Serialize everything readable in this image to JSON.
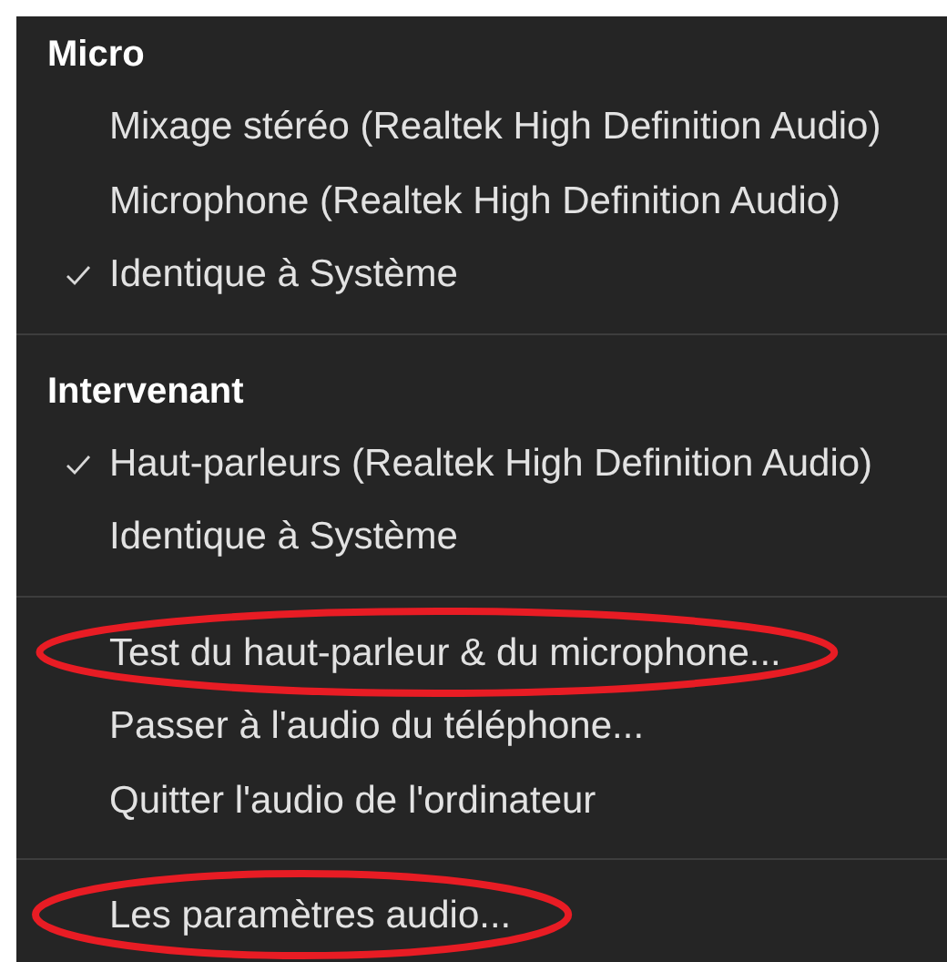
{
  "menu": {
    "sections": [
      {
        "header": "Micro",
        "items": [
          {
            "label": "Mixage stéréo (Realtek High Definition Audio)",
            "checked": false,
            "circled": false
          },
          {
            "label": "Microphone (Realtek High Definition Audio)",
            "checked": false,
            "circled": false
          },
          {
            "label": "Identique à Système",
            "checked": true,
            "circled": false
          }
        ]
      },
      {
        "header": "Intervenant",
        "items": [
          {
            "label": "Haut-parleurs (Realtek High Definition Audio)",
            "checked": true,
            "circled": false
          },
          {
            "label": "Identique à Système",
            "checked": false,
            "circled": false
          }
        ]
      },
      {
        "items": [
          {
            "label": "Test du haut-parleur & du microphone...",
            "checked": false,
            "circled": true
          },
          {
            "label": "Passer à l'audio du téléphone...",
            "checked": false,
            "circled": false
          },
          {
            "label": "Quitter l'audio de l'ordinateur",
            "checked": false,
            "circled": false
          }
        ]
      },
      {
        "items": [
          {
            "label": "Les paramètres audio...",
            "checked": false,
            "circled": true
          }
        ]
      }
    ]
  }
}
